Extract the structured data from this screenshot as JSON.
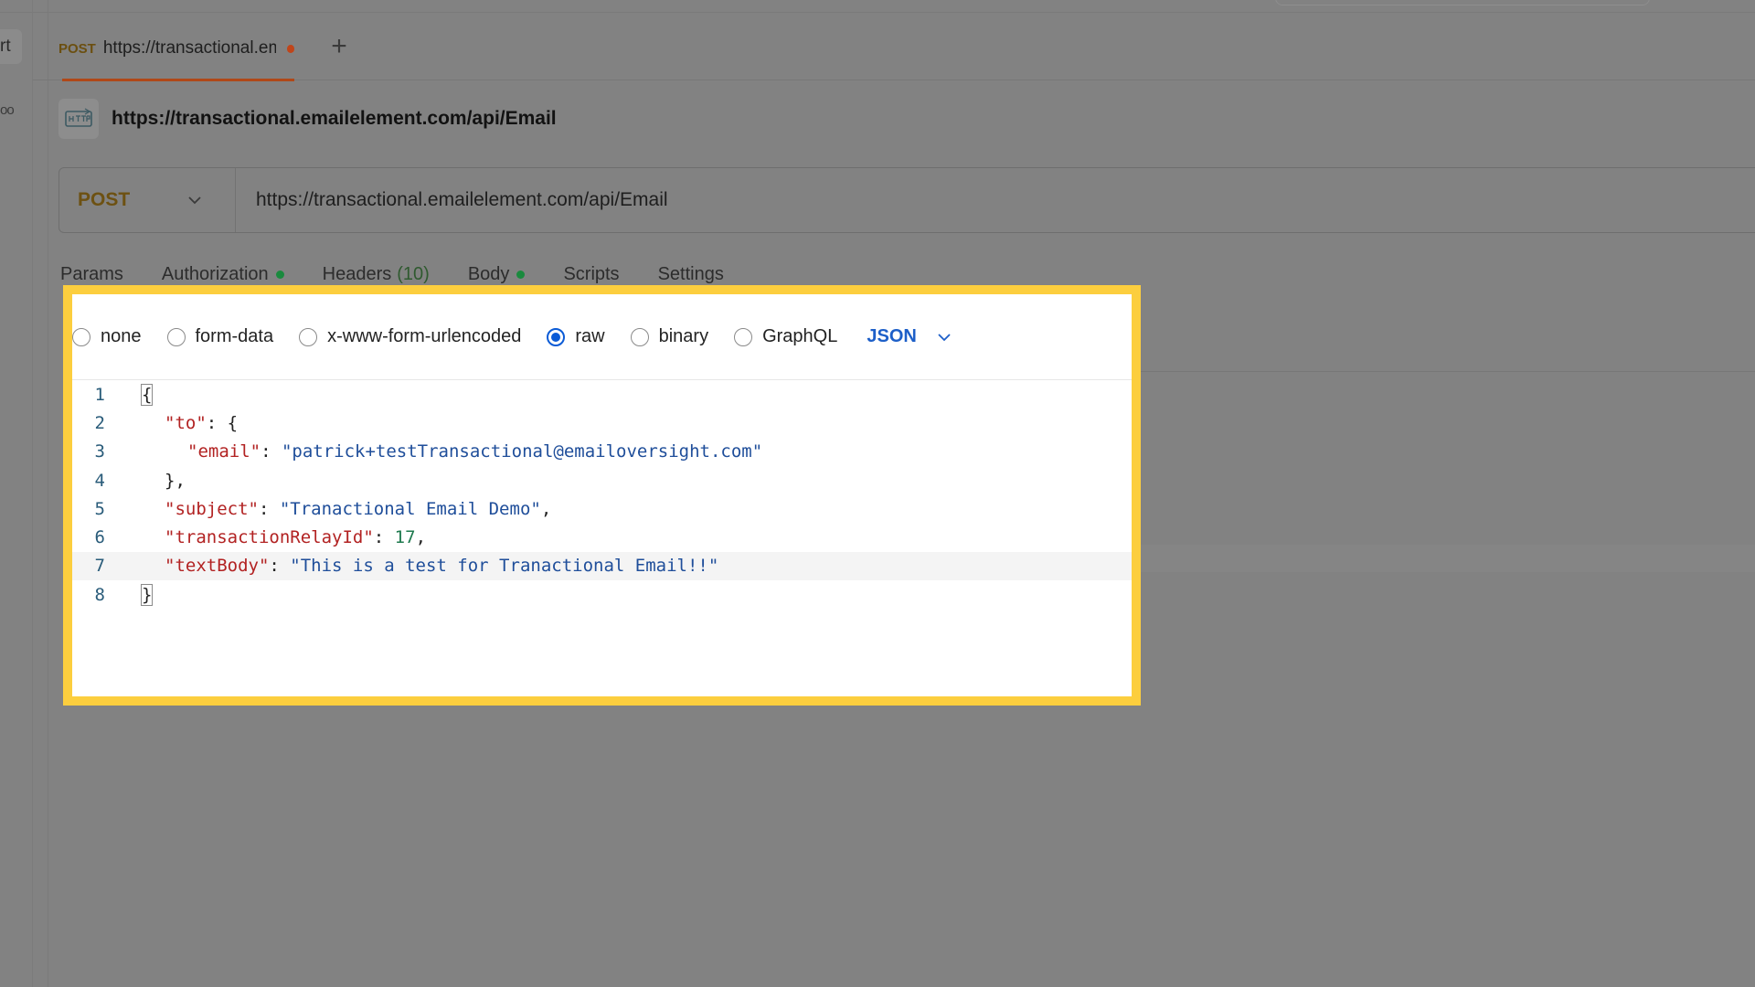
{
  "tabstrip": {
    "rail_tab_text": "rt",
    "rail_dots": "oo",
    "active_tab": {
      "method": "POST",
      "url": "https://transactional.emailelement.com/api/Email"
    },
    "new_tab_label": "+"
  },
  "request": {
    "title": "https://transactional.emailelement.com/api/Email",
    "method": "POST",
    "url": "https://transactional.emailelement.com/api/Email"
  },
  "request_tabs": [
    {
      "label": "Params"
    },
    {
      "label": "Authorization",
      "dot": true
    },
    {
      "label": "Headers",
      "count": "(10)"
    },
    {
      "label": "Body",
      "dot": true,
      "active": true
    },
    {
      "label": "Scripts"
    },
    {
      "label": "Settings"
    }
  ],
  "body_modes": [
    {
      "label": "none",
      "checked": false
    },
    {
      "label": "form-data",
      "checked": false
    },
    {
      "label": "x-www-form-urlencoded",
      "checked": false
    },
    {
      "label": "raw",
      "checked": true
    },
    {
      "label": "binary",
      "checked": false
    },
    {
      "label": "GraphQL",
      "checked": false
    }
  ],
  "body_language": "JSON",
  "editor": {
    "line_numbers": [
      "1",
      "2",
      "3",
      "4",
      "5",
      "6",
      "7",
      "8"
    ],
    "l1": "{",
    "l2_key": "\"to\"",
    "l2_rest": ": {",
    "l3_key": "\"email\"",
    "l3_sep": ": ",
    "l3_val": "\"patrick+testTransactional@emailoversight.com\"",
    "l4": "},",
    "l5_key": "\"subject\"",
    "l5_sep": ": ",
    "l5_val": "\"Tranactional Email Demo\"",
    "l5_end": ",",
    "l6_key": "\"transactionRelayId\"",
    "l6_sep": ": ",
    "l6_val": "17",
    "l6_end": ",",
    "l7_key": "\"textBody\"",
    "l7_sep": ": ",
    "l7_val": "\"This is a test for Tranactional Email!!\"",
    "l8": "}"
  },
  "colors": {
    "highlight_border": "#fcce3e",
    "accent_orange": "#b04818",
    "status_green": "#1a8a3e",
    "radio_blue": "#0b5bd6"
  }
}
